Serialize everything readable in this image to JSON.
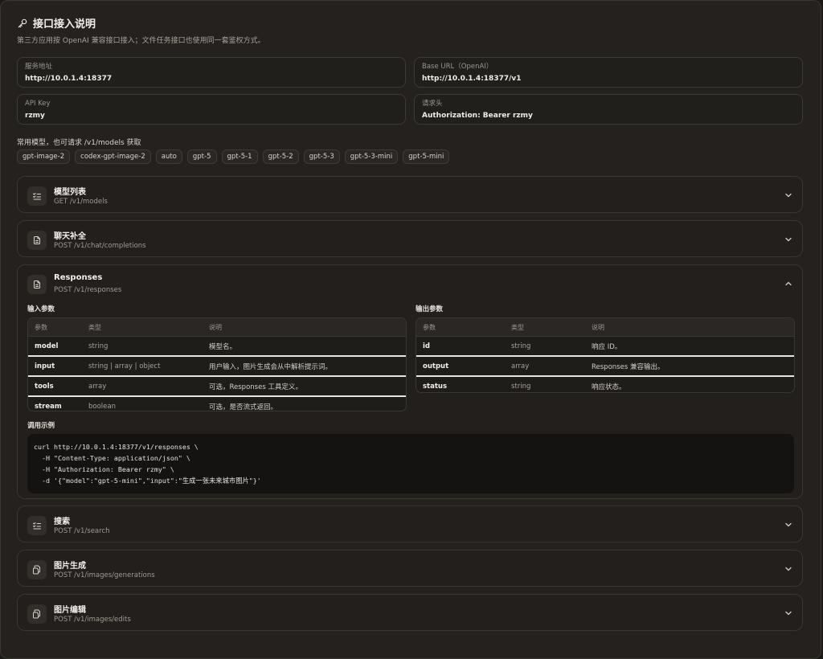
{
  "header": {
    "title": "接口接入说明",
    "subtitle": "第三方应用按 OpenAI 兼容接口接入；文件任务接口也使用同一套鉴权方式。"
  },
  "fields": [
    {
      "label": "服务地址",
      "value": "http://10.0.1.4:18377"
    },
    {
      "label": "Base URL（OpenAI）",
      "value": "http://10.0.1.4:18377/v1"
    },
    {
      "label": "API Key",
      "value": "rzmy"
    },
    {
      "label": "请求头",
      "value": "Authorization: Bearer rzmy"
    }
  ],
  "models": {
    "label": "常用模型，也可请求 /v1/models 获取",
    "items": [
      "gpt-image-2",
      "codex-gpt-image-2",
      "auto",
      "gpt-5",
      "gpt-5-1",
      "gpt-5-2",
      "gpt-5-3",
      "gpt-5-3-mini",
      "gpt-5-mini"
    ]
  },
  "sections": [
    {
      "title": "模型列表",
      "endpoint": "GET /v1/models",
      "icon": "list-check-icon",
      "expanded": false
    },
    {
      "title": "聊天补全",
      "endpoint": "POST /v1/chat/completions",
      "icon": "document-icon",
      "expanded": false
    },
    {
      "title": "Responses",
      "endpoint": "POST /v1/responses",
      "icon": "document-icon",
      "expanded": true
    },
    {
      "title": "搜索",
      "endpoint": "POST /v1/search",
      "icon": "list-check-icon",
      "expanded": false
    },
    {
      "title": "图片生成",
      "endpoint": "POST /v1/images/generations",
      "icon": "files-icon",
      "expanded": false
    },
    {
      "title": "图片编辑",
      "endpoint": "POST /v1/images/edits",
      "icon": "files-icon",
      "expanded": false
    }
  ],
  "responses_detail": {
    "input_label": "输入参数",
    "output_label": "输出参数",
    "headers": [
      "参数",
      "类型",
      "说明"
    ],
    "input_rows": [
      [
        "model",
        "string",
        "模型名。"
      ],
      [
        "input",
        "string | array | object",
        "用户输入，图片生成会从中解析提示词。"
      ],
      [
        "tools",
        "array",
        "可选，Responses 工具定义。"
      ],
      [
        "stream",
        "boolean",
        "可选，是否流式返回。"
      ]
    ],
    "output_rows": [
      [
        "id",
        "string",
        "响应 ID。"
      ],
      [
        "output",
        "array",
        "Responses 兼容输出。"
      ],
      [
        "status",
        "string",
        "响应状态。"
      ]
    ],
    "example_label": "调用示例",
    "example_code": "curl http://10.0.1.4:18377/v1/responses \\\n  -H \"Content-Type: application/json\" \\\n  -H \"Authorization: Bearer rzmy\" \\\n  -d '{\"model\":\"gpt-5-mini\",\"input\":\"生成一张未来城市图片\"}'"
  }
}
